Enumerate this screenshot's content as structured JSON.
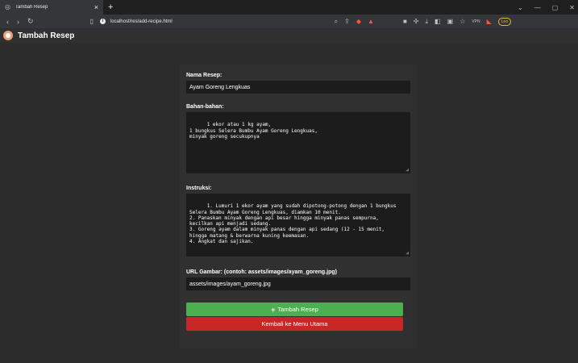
{
  "browser": {
    "tab_title": "Tambah Resep",
    "tab_close": "×",
    "new_tab": "+",
    "url": "localhost/res/add-recipe.html",
    "vpn_label": "VPN",
    "profile_label": "Leo"
  },
  "app": {
    "title": "Tambah Resep"
  },
  "form": {
    "nama_label": "Nama Resep:",
    "nama_value": "Ayam Goreng Lengkuas",
    "bahan_label": "Bahan-bahan:",
    "bahan_value": "1 ekor atau 1 kg ayam,\n1 bungkus Selera Bumbu Ayam Goreng Lengkuas,\nminyak goreng secukupnya",
    "instruksi_label": "Instruksi:",
    "instruksi_value": "1. Lumuri 1 ekor ayam yang sudah dipotong-potong dengan 1 bungkus\nSelera Bumbu Ayam Goreng Lengkuas, diamkan 10 menit.\n2. Panaskan minyak dengan api besar hingga minyak panas sempurna,\nkecilkan api menjadi sedang.\n3. Goreng ayam dalam minyak panas dengan api sedang (12 - 15 menit,\nhingga matang & berwarna kuning keemasan.\n4. Angkat dan sajikan.",
    "gambar_label": "URL Gambar: (contoh: assets/images/ayam_goreng.jpg)",
    "gambar_value": "assets/images/ayam_goreng.jpg",
    "add_button": "Tambah Resep",
    "back_button": "Kembali ke Menu Utama"
  }
}
